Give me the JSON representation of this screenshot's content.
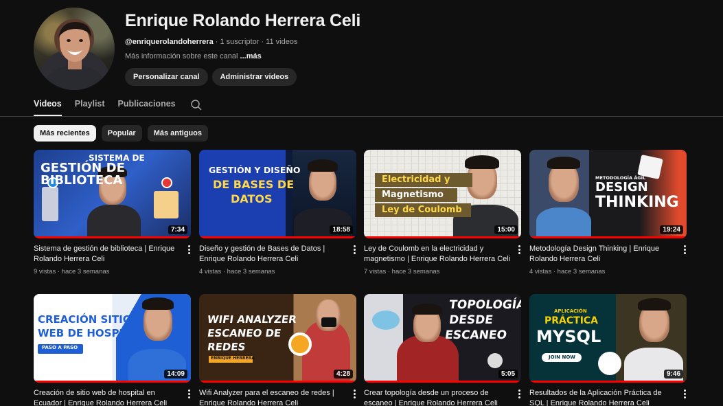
{
  "channel": {
    "name": "Enrique Rolando Herrera Celi",
    "handle": "@enriquerolandoherrera",
    "subscribers": "1 suscriptor",
    "video_count": "11 videos",
    "separator": "·",
    "about_text": "Más información sobre este canal",
    "about_more": "...más",
    "customize_button": "Personalizar canal",
    "manage_button": "Administrar videos"
  },
  "tabs": [
    {
      "label": "Videos",
      "active": true
    },
    {
      "label": "Playlist",
      "active": false
    },
    {
      "label": "Publicaciones",
      "active": false
    }
  ],
  "tab_search_icon": "search-icon",
  "chips": [
    {
      "label": "Más recientes",
      "active": true
    },
    {
      "label": "Popular",
      "active": false
    },
    {
      "label": "Más antiguos",
      "active": false
    }
  ],
  "colors": {
    "background": "#0f0f0f",
    "progress": "#ff0000",
    "chip_active": "#f1f1f1",
    "pill": "#272727"
  },
  "videos": [
    {
      "title": "Sistema de gestión de biblioteca | Enrique Rolando Herrera Celi",
      "views": "9 vistas",
      "age": "hace 3 semanas",
      "duration": "7:34",
      "thumb_lines": [
        "Sistema de",
        "Gestión de biblioteca"
      ]
    },
    {
      "title": "Diseño y gestión de Bases de Datos | Enrique Rolando Herrera Celi",
      "views": "4 vistas",
      "age": "hace 3 semanas",
      "duration": "18:58",
      "thumb_lines": [
        "Gestión y diseño",
        "de bases de",
        "datos"
      ]
    },
    {
      "title": "Ley de Coulomb en la electricidad y magnetismo | Enrique Rolando Herrera Celi",
      "views": "7 vistas",
      "age": "hace 3 semanas",
      "duration": "15:00",
      "thumb_lines": [
        "Electricidad y",
        "Magnetismo",
        "Ley de Coulomb"
      ]
    },
    {
      "title": "Metodología Design Thinking | Enrique Rolando Herrera Celi",
      "views": "4 vistas",
      "age": "hace 3 semanas",
      "duration": "19:24",
      "thumb_lines": [
        "Metodología ágil",
        "Design",
        "Thinking"
      ]
    },
    {
      "title": "Creación de sitio web de hospital en Ecuador | Enrique Rolando Herrera Celi",
      "views": "",
      "age": "",
      "duration": "14:09",
      "thumb_lines": [
        "Creación sitio",
        "web de hospital",
        "Paso a paso"
      ]
    },
    {
      "title": "Wifi Analyzer para el escaneo de redes | Enrique Rolando Herrera Celi",
      "views": "",
      "age": "",
      "duration": "4:28",
      "thumb_lines": [
        "Wifi analyzer",
        "escaneo de",
        "redes",
        "Enrique Herrera"
      ]
    },
    {
      "title": "Crear topología desde un proceso de escaneo | Enrique Rolando Herrera Celi",
      "views": "",
      "age": "",
      "duration": "5:05",
      "thumb_lines": [
        "Topología",
        "desde",
        "escaneo"
      ]
    },
    {
      "title": "Resultados de la Aplicación Práctica de SQL | Enrique Rolando Herrera Celi",
      "views": "",
      "age": "",
      "duration": "9:46",
      "thumb_lines": [
        "Aplicación",
        "Práctica",
        "MySQL",
        "JOIN NOW"
      ]
    }
  ]
}
